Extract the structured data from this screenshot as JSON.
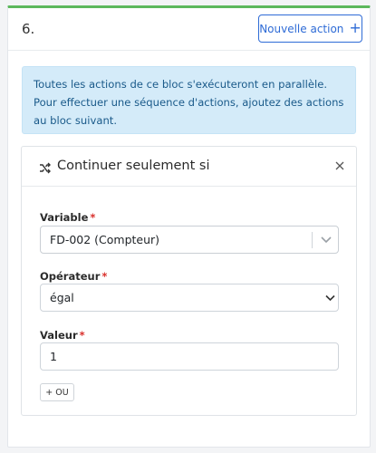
{
  "block": {
    "step_number": "6.",
    "new_action_label": "Nouvelle action",
    "info_text": "Toutes les actions de ce bloc s'exécuteront en parallèle. Pour effectuer une séquence d'actions, ajoutez des actions au bloc suivant."
  },
  "condition_card": {
    "title": "Continuer seulement si",
    "variable": {
      "label": "Variable",
      "required_mark": "*",
      "value": "FD-002 (Compteur)"
    },
    "operator": {
      "label": "Opérateur",
      "required_mark": "*",
      "value": "égal"
    },
    "value_field": {
      "label": "Valeur",
      "required_mark": "*",
      "value": "1"
    },
    "or_button_label": "+ OU"
  },
  "colors": {
    "accent_green": "#5cb85c",
    "primary_blue": "#2e6bd6",
    "info_bg": "#d4ebf9",
    "required_red": "#d9302c"
  },
  "icons": [
    "plus-icon",
    "shuffle-icon",
    "close-icon",
    "chevron-down-icon"
  ]
}
